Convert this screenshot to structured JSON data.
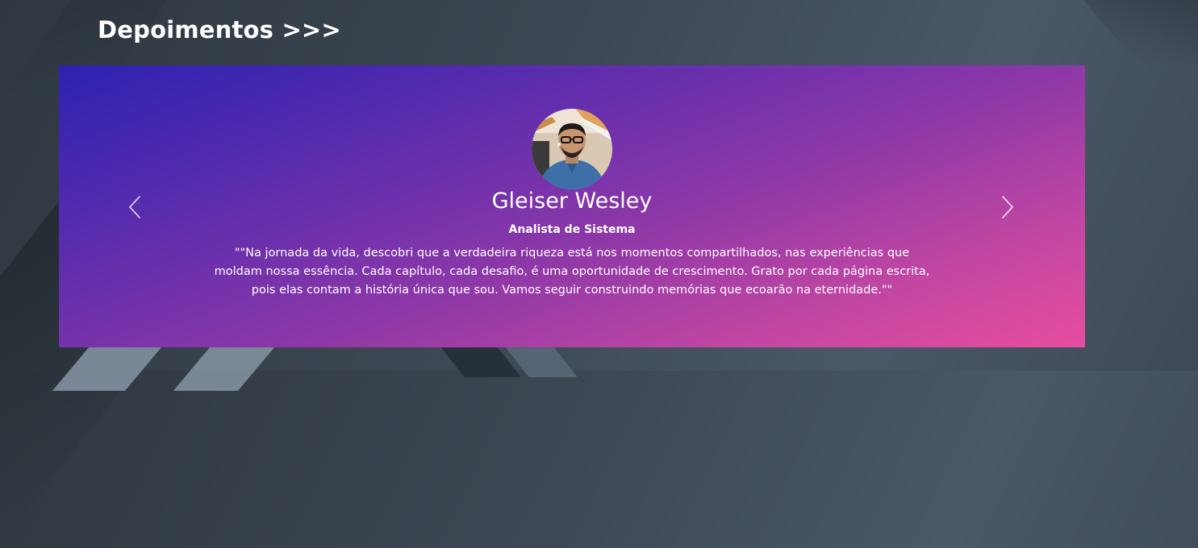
{
  "section": {
    "title": "Depoimentos >>>"
  },
  "carousel": {
    "prev_icon": "chevron-left-icon",
    "next_icon": "chevron-right-icon",
    "slides": [
      {
        "name": "Gleiser Wesley",
        "role": "Analista de Sistema",
        "quote": "\"\"Na jornada da vida, descobri que a verdadeira riqueza está nos momentos compartilhados, nas experiências que moldam nossa essência. Cada capítulo, cada desafio, é uma oportunidade de crescimento. Grato por cada página escrita, pois elas contam a história única que sou. Vamos seguir construindo memórias que ecoarão na eternidade.\"\""
      }
    ]
  },
  "colors": {
    "gradient_start": "#2c22b0",
    "gradient_end": "#e74d9e",
    "text": "#ffffff"
  }
}
